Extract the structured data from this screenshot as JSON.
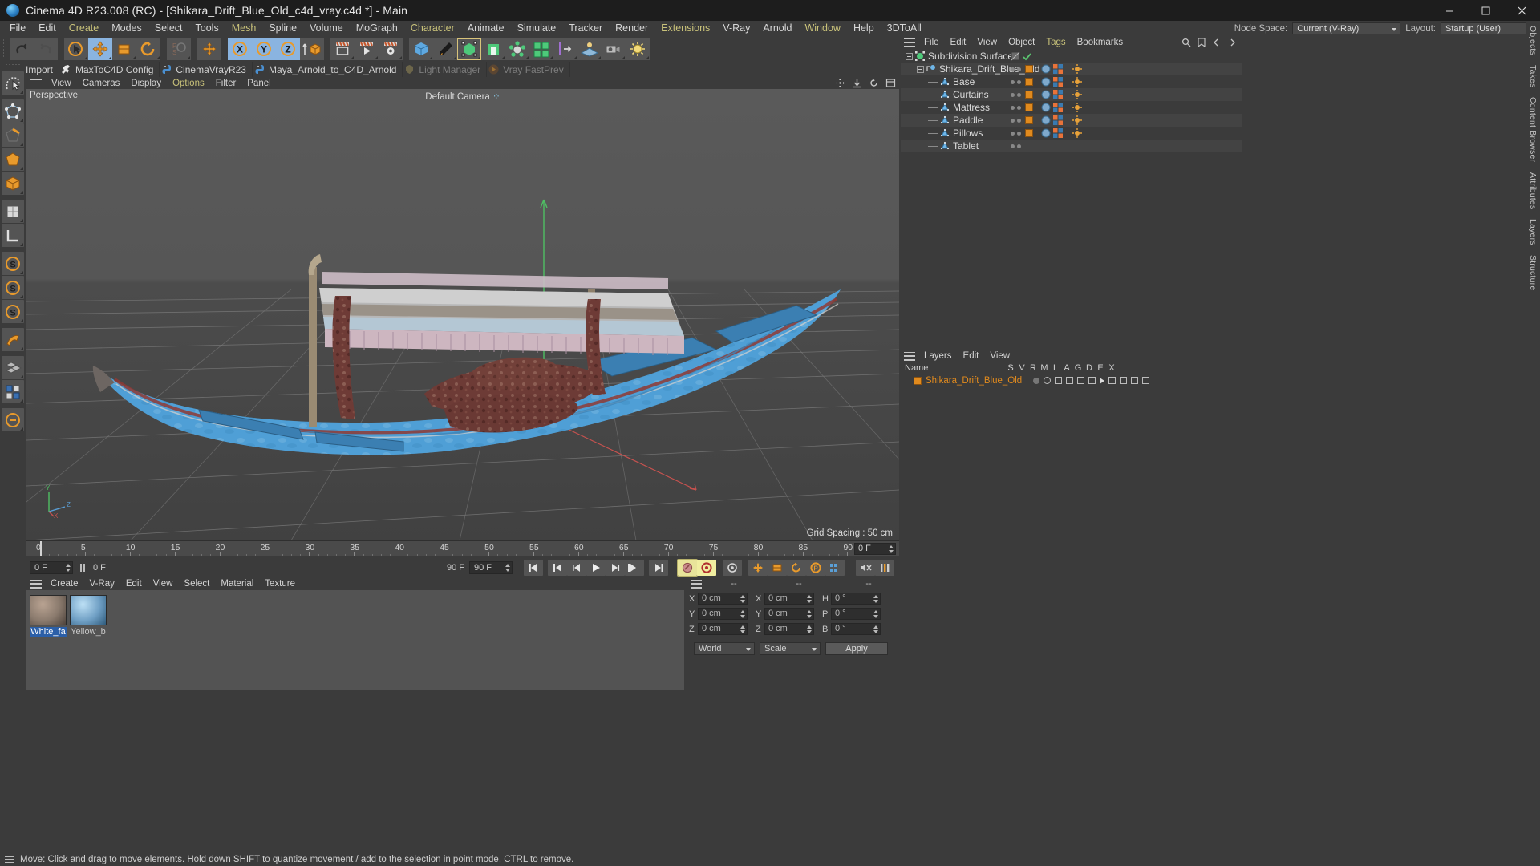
{
  "window": {
    "title": "Cinema 4D R23.008 (RC) - [Shikara_Drift_Blue_Old_c4d_vray.c4d *] - Main",
    "app_icon": "cinema4d-logo-icon",
    "minimize": "minimize-icon",
    "maximize": "maximize-icon",
    "close": "close-icon"
  },
  "menubar": {
    "items": [
      {
        "label": "File",
        "hl": false
      },
      {
        "label": "Edit",
        "hl": false
      },
      {
        "label": "Create",
        "hl": true
      },
      {
        "label": "Modes",
        "hl": false
      },
      {
        "label": "Select",
        "hl": false
      },
      {
        "label": "Tools",
        "hl": false
      },
      {
        "label": "Mesh",
        "hl": true
      },
      {
        "label": "Spline",
        "hl": false
      },
      {
        "label": "Volume",
        "hl": false
      },
      {
        "label": "MoGraph",
        "hl": false
      },
      {
        "label": "Character",
        "hl": true
      },
      {
        "label": "Animate",
        "hl": false
      },
      {
        "label": "Simulate",
        "hl": false
      },
      {
        "label": "Tracker",
        "hl": false
      },
      {
        "label": "Render",
        "hl": false
      },
      {
        "label": "Extensions",
        "hl": true
      },
      {
        "label": "V-Ray",
        "hl": false
      },
      {
        "label": "Arnold",
        "hl": false
      },
      {
        "label": "Window",
        "hl": true
      },
      {
        "label": "Help",
        "hl": false
      },
      {
        "label": "3DToAll",
        "hl": false
      }
    ],
    "node_space_label": "Node Space:",
    "node_space_value": "Current (V-Ray)",
    "layout_label": "Layout:",
    "layout_value": "Startup (User)"
  },
  "toolbar": {
    "undo_icon": "undo-icon",
    "redo_icon": "redo-icon",
    "groups": [
      {
        "buttons": [
          {
            "name": "select-live-tool",
            "icon": "cursor-circle-icon",
            "state": "normal"
          },
          {
            "name": "move-tool",
            "icon": "move-arrows-icon",
            "state": "selected"
          },
          {
            "name": "scale-tool",
            "icon": "scale-box-icon",
            "state": "normal"
          },
          {
            "name": "rotate-tool",
            "icon": "rotate-circle-icon",
            "state": "normal"
          }
        ]
      },
      {
        "buttons": [
          {
            "name": "ps-coordinate-tool",
            "icon": "ps-letters-icon",
            "state": "disabled"
          }
        ]
      },
      {
        "buttons": [
          {
            "name": "move-axis-tool",
            "icon": "axis-move-icon",
            "state": "normal"
          }
        ]
      },
      {
        "buttons": [
          {
            "name": "x-axis-lock",
            "icon": "x-axis-icon",
            "state": "selected"
          },
          {
            "name": "y-axis-lock",
            "icon": "y-axis-icon",
            "state": "selected"
          },
          {
            "name": "z-axis-lock",
            "icon": "z-axis-icon",
            "state": "selected"
          },
          {
            "name": "world-object-axis-toggle",
            "icon": "world-coord-icon",
            "state": "normal"
          }
        ]
      },
      {
        "buttons": [
          {
            "name": "render-view-button",
            "icon": "render-frame-icon",
            "state": "normal"
          },
          {
            "name": "render-to-picture-viewer-button",
            "icon": "render-play-icon",
            "state": "normal"
          },
          {
            "name": "render-settings-button",
            "icon": "render-gear-icon",
            "state": "normal"
          }
        ]
      },
      {
        "buttons": [
          {
            "name": "add-cube-button",
            "icon": "cube-blue-icon",
            "state": "normal"
          },
          {
            "name": "add-spline-pen-button",
            "icon": "pen-icon",
            "state": "normal"
          },
          {
            "name": "add-nurbs-button",
            "icon": "subdivision-green-icon",
            "state": "highlight"
          },
          {
            "name": "add-array-button",
            "icon": "green-box-icon",
            "state": "normal"
          },
          {
            "name": "add-scene-nodes-button",
            "icon": "molecule-icon",
            "state": "normal"
          },
          {
            "name": "add-modeling-object-button",
            "icon": "multi-cube-icon",
            "state": "normal"
          },
          {
            "name": "add-deformer-button",
            "icon": "deformer-icon",
            "state": "normal"
          },
          {
            "name": "add-environment-button",
            "icon": "floor-env-icon",
            "state": "normal"
          },
          {
            "name": "add-camera-button",
            "icon": "camera-icon",
            "state": "normal"
          },
          {
            "name": "add-light-button",
            "icon": "light-bulb-icon",
            "state": "normal"
          }
        ]
      }
    ]
  },
  "pluginbar": {
    "items": [
      {
        "label": "Import",
        "icon": "import-icon",
        "dim": false
      },
      {
        "label": "MaxToC4D Config",
        "icon": "wrench-icon",
        "dim": false
      },
      {
        "label": "CinemaVrayR23",
        "icon": "python-icon",
        "dim": false
      },
      {
        "label": "Maya_Arnold_to_C4D_Arnold",
        "icon": "python-icon",
        "dim": false
      },
      {
        "label": "Light Manager",
        "icon": "shield-icon",
        "dim": true
      },
      {
        "label": "Vray FastPrev",
        "icon": "vray-arrow-icon",
        "dim": true
      }
    ]
  },
  "left_tools": [
    {
      "name": "tool-live-selection",
      "icon": "lasso-select-icon",
      "state": "normal"
    },
    {
      "name": "tool-point-mode",
      "icon": "point-mode-icon",
      "state": "normal"
    },
    {
      "name": "tool-edge-mode",
      "icon": "edge-mode-icon",
      "state": "normal"
    },
    {
      "name": "tool-polygon-mode",
      "icon": "polygon-mode-icon",
      "state": "normal"
    },
    {
      "name": "tool-model-mode",
      "icon": "model-mode-icon",
      "state": "normal"
    },
    {
      "name": "tool-texture-mode",
      "icon": "texture-mode-icon",
      "state": "normal"
    },
    {
      "name": "tool-workplane-mode",
      "icon": "workplane-icon",
      "state": "normal"
    },
    {
      "name": "tool-enable-axis",
      "icon": "axis-s-icon",
      "state": "normal"
    },
    {
      "name": "tool-enable-snap",
      "icon": "snap-s-icon",
      "state": "normal"
    },
    {
      "name": "tool-quantize",
      "icon": "quantize-s-icon",
      "state": "normal"
    },
    {
      "name": "tool-viewport-solo",
      "icon": "solo-icon",
      "state": "normal"
    },
    {
      "name": "tool-uv-mesh",
      "icon": "uv-mesh-icon",
      "state": "normal"
    },
    {
      "name": "tool-uv-polygon",
      "icon": "uv-poly-icon",
      "state": "normal"
    },
    {
      "name": "tool-animation-layer",
      "icon": "anim-layer-icon",
      "state": "normal"
    }
  ],
  "viewport": {
    "menu": [
      "View",
      "Cameras",
      "Display",
      "Options",
      "Filter",
      "Panel"
    ],
    "menu_highlight": "Options",
    "perspective_label": "Perspective",
    "camera_label": "Default Camera",
    "grid_spacing": "Grid Spacing : 50 cm",
    "axis_labels": {
      "x": "X",
      "y": "Y",
      "z": "Z"
    },
    "corner_icons": [
      "pan-viewport-icon",
      "dolly-viewport-icon",
      "rotate-viewport-icon",
      "maximize-viewport-icon"
    ],
    "scene_description": "Blue Shikara (Kashmiri boat) 3D model with canopy, curtains, mattress, pillows and paddle"
  },
  "timeline": {
    "ticks": [
      0,
      5,
      10,
      15,
      20,
      25,
      30,
      35,
      40,
      45,
      50,
      55,
      60,
      65,
      70,
      75,
      80,
      85,
      90
    ],
    "current_frame_field": "0 F",
    "playhead_frame": 0
  },
  "animbar": {
    "current_frame": "0 F",
    "preview_frame": "0 F",
    "end_frame": "90 F",
    "range_end": "90 F",
    "transport": [
      {
        "name": "go-to-start-button",
        "icon": "skip-start-icon"
      },
      {
        "name": "previous-keyframe-button",
        "icon": "prev-key-icon"
      },
      {
        "name": "previous-frame-button",
        "icon": "step-back-icon"
      },
      {
        "name": "play-button",
        "icon": "play-icon"
      },
      {
        "name": "next-frame-button",
        "icon": "step-forward-icon"
      },
      {
        "name": "next-keyframe-button",
        "icon": "next-key-icon"
      },
      {
        "name": "go-to-end-button",
        "icon": "skip-end-icon"
      }
    ],
    "record_tools": [
      {
        "name": "record-active-objects-button",
        "icon": "record-key-icon",
        "state": "yellow"
      },
      {
        "name": "autokeying-button",
        "icon": "autokey-icon",
        "state": "yellow-selected"
      },
      {
        "name": "keyframe-selection-button",
        "icon": "key-selection-icon",
        "state": "normal"
      },
      {
        "name": "position-key-button",
        "icon": "position-key-icon",
        "state": "normal"
      },
      {
        "name": "scale-key-button",
        "icon": "scale-key-icon",
        "state": "normal"
      },
      {
        "name": "rotation-key-button",
        "icon": "rotation-key-icon",
        "state": "normal"
      },
      {
        "name": "parameter-key-button",
        "icon": "param-key-icon",
        "state": "normal"
      },
      {
        "name": "point-level-animation-button",
        "icon": "pla-icon",
        "state": "normal"
      }
    ],
    "right_tools": [
      {
        "name": "sound-toggle-button",
        "icon": "sound-off-icon"
      },
      {
        "name": "timeline-layout-button",
        "icon": "timeline-bars-icon"
      }
    ]
  },
  "material_manager": {
    "menu": [
      "Create",
      "V-Ray",
      "Edit",
      "View",
      "Select",
      "Material",
      "Texture"
    ],
    "materials": [
      {
        "name": "White_fa",
        "selected": true,
        "swatch": "#8a7a6d"
      },
      {
        "name": "Yellow_b",
        "selected": false,
        "swatch": "#6f9fc4"
      }
    ]
  },
  "coordinates": {
    "header_dashes": [
      "--",
      "--",
      "--"
    ],
    "rows": [
      {
        "label1": "X",
        "v1": "0 cm",
        "label2": "X",
        "v2": "0 cm",
        "label3": "H",
        "v3": "0 °"
      },
      {
        "label1": "Y",
        "v1": "0 cm",
        "label2": "Y",
        "v2": "0 cm",
        "label3": "P",
        "v3": "0 °"
      },
      {
        "label1": "Z",
        "v1": "0 cm",
        "label2": "Z",
        "v2": "0 cm",
        "label3": "B",
        "v3": "0 °"
      }
    ],
    "space_select": "World",
    "mode_select": "Scale",
    "apply_button": "Apply"
  },
  "object_manager": {
    "menu": [
      "File",
      "Edit",
      "View",
      "Object",
      "Tags",
      "Bookmarks"
    ],
    "menu_highlight": "Tags",
    "search_icon": "search-icon",
    "items": [
      {
        "name": "Subdivision Surface",
        "depth": 0,
        "icon": "subdivision-icon",
        "expander": true,
        "has_tags": false,
        "selected": false
      },
      {
        "name": "Shikara_Drift_Blue_Old",
        "depth": 1,
        "icon": "null-object-icon",
        "expander": true,
        "has_tags": true,
        "selected": false
      },
      {
        "name": "Base",
        "depth": 2,
        "icon": "polygon-object-icon",
        "expander": false,
        "has_tags": true,
        "selected": false
      },
      {
        "name": "Curtains",
        "depth": 2,
        "icon": "polygon-object-icon",
        "expander": false,
        "has_tags": true,
        "selected": false
      },
      {
        "name": "Mattress",
        "depth": 2,
        "icon": "polygon-object-icon",
        "expander": false,
        "has_tags": true,
        "selected": false
      },
      {
        "name": "Paddle",
        "depth": 2,
        "icon": "polygon-object-icon",
        "expander": false,
        "has_tags": true,
        "selected": false
      },
      {
        "name": "Pillows",
        "depth": 2,
        "icon": "polygon-object-icon",
        "expander": false,
        "has_tags": true,
        "selected": false
      },
      {
        "name": "Tablet",
        "depth": 2,
        "icon": "polygon-object-icon",
        "expander": false,
        "has_tags": false,
        "selected": false
      }
    ]
  },
  "layer_manager": {
    "menu": [
      "Layers",
      "Edit",
      "View"
    ],
    "columns": [
      "Name",
      "S",
      "V",
      "R",
      "M",
      "L",
      "A",
      "G",
      "D",
      "E",
      "X"
    ],
    "rows": [
      {
        "name": "Shikara_Drift_Blue_Old",
        "color": "#e08a1e"
      }
    ]
  },
  "right_tabs": [
    "Objects",
    "Takes",
    "Content Browser",
    "Attributes",
    "Layers",
    "Structure"
  ],
  "statusbar": {
    "message": "Move: Click and drag to move elements. Hold down SHIFT to quantize movement / add to the selection in point mode, CTRL to remove."
  },
  "colors": {
    "accent_orange": "#e08a1e",
    "selected_blue": "#8ab4e0",
    "panel_bg": "#3b3b3b",
    "viewport_bg": "#535353",
    "menu_highlight": "#c9c27a"
  }
}
